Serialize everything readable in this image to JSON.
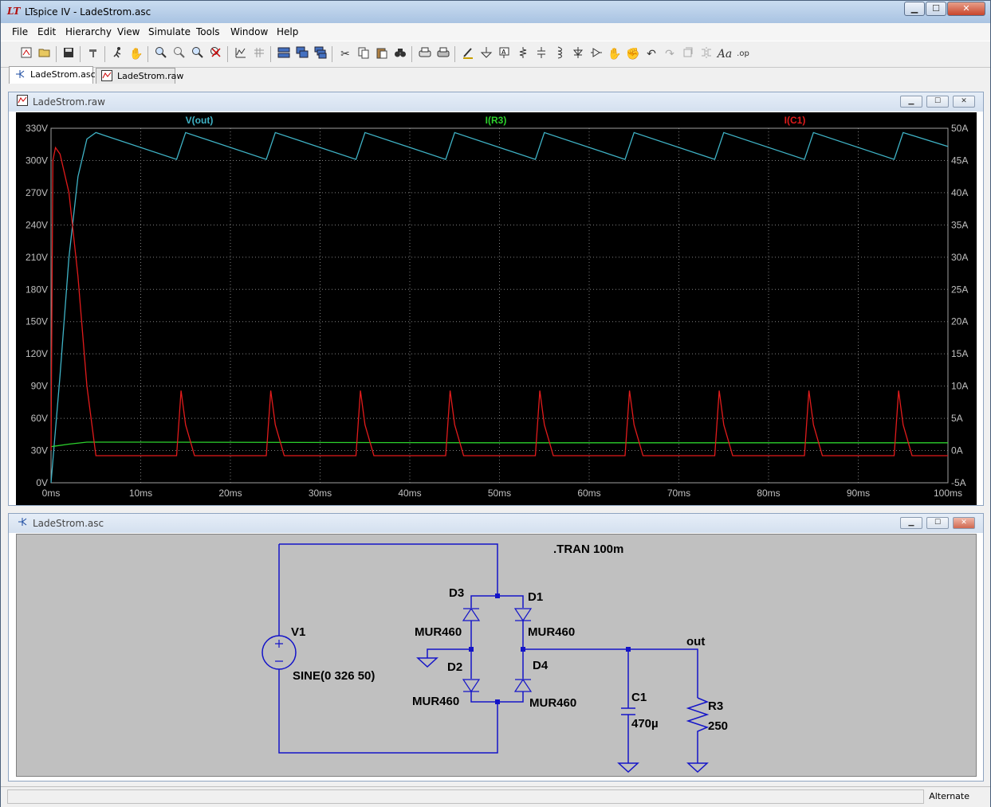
{
  "window": {
    "title": "LTspice IV - LadeStrom.asc",
    "min_label": "▁",
    "max_label": "☐",
    "close_label": "✕"
  },
  "menu": [
    "File",
    "Edit",
    "Hierarchy",
    "View",
    "Simulate",
    "Tools",
    "Window",
    "Help"
  ],
  "toolbar_icons": [
    "new-schematic-icon",
    "open-icon",
    "save-icon",
    "hammer-icon",
    "run-icon",
    "hand-pan-icon",
    "zoom-in-icon",
    "zoom-search-icon",
    "zoom-out-icon",
    "zoom-cancel-icon",
    "autorange-icon",
    "grid-icon",
    "tile-horizontal-icon",
    "cascade-icon",
    "tile-vertical-icon",
    "cut-icon",
    "copy-icon",
    "paste-icon",
    "find-icon",
    "print-setup-icon",
    "print-icon",
    "draw-wire-icon",
    "ground-icon",
    "label-net-icon",
    "resistor-icon",
    "capacitor-icon",
    "inductor-icon",
    "diode-icon",
    "component-icon",
    "move-icon",
    "drag-icon",
    "undo-icon",
    "redo-icon",
    "rotate-icon",
    "mirror-icon",
    "text-icon",
    "spice-directive-icon"
  ],
  "tabs": [
    {
      "label": "LadeStrom.asc",
      "icon": "schematic-icon",
      "active": true
    },
    {
      "label": "LadeStrom.raw",
      "icon": "waveform-icon",
      "active": false
    }
  ],
  "plot_window": {
    "title": "LadeStrom.raw",
    "traces": [
      {
        "label": "V(out)",
        "color": "#3fb3c6"
      },
      {
        "label": "I(R3)",
        "color": "#2cd12c"
      },
      {
        "label": "I(C1)",
        "color": "#e11b1b"
      }
    ],
    "left_ticks": [
      "330V",
      "300V",
      "270V",
      "240V",
      "210V",
      "180V",
      "150V",
      "120V",
      "90V",
      "60V",
      "30V",
      "0V"
    ],
    "right_ticks": [
      "50A",
      "45A",
      "40A",
      "35A",
      "30A",
      "25A",
      "20A",
      "15A",
      "10A",
      "5A",
      "0A",
      "-5A"
    ],
    "x_ticks": [
      "0ms",
      "10ms",
      "20ms",
      "30ms",
      "40ms",
      "50ms",
      "60ms",
      "70ms",
      "80ms",
      "90ms",
      "100ms"
    ]
  },
  "chart_data": {
    "type": "line",
    "x_unit": "ms",
    "xlim": [
      0,
      100
    ],
    "ylim_left": [
      0,
      330
    ],
    "ylim_right": [
      -5,
      50
    ],
    "series": [
      {
        "name": "V(out)",
        "axis": "left",
        "x": [
          0,
          1,
          2,
          3,
          4,
          5,
          14,
          15,
          24,
          25,
          34,
          35,
          44,
          45,
          54,
          55,
          64,
          65,
          74,
          75,
          84,
          85,
          94,
          95,
          100
        ],
        "y": [
          0,
          100,
          210,
          285,
          320,
          326,
          301,
          326,
          301,
          326,
          301,
          326,
          301,
          326,
          301,
          326,
          301,
          326,
          301,
          326,
          301,
          326,
          301,
          326,
          313
        ]
      },
      {
        "name": "I(R3)",
        "axis": "right",
        "x": [
          0,
          2,
          4,
          5,
          10,
          50,
          100
        ],
        "y": [
          0.6,
          1.0,
          1.3,
          1.3,
          1.3,
          1.2,
          1.2
        ]
      },
      {
        "name": "I(C1)",
        "axis": "right",
        "x": [
          0,
          0.2,
          0.5,
          1,
          2,
          3,
          4,
          5,
          14,
          14.5,
          15,
          16,
          24,
          24.5,
          25,
          26,
          34,
          34.5,
          35,
          36,
          44,
          44.5,
          45,
          46,
          54,
          54.5,
          55,
          56,
          64,
          64.5,
          65,
          66,
          74,
          74.5,
          75,
          76,
          84,
          84.5,
          85,
          86,
          94,
          94.5,
          95,
          96,
          100
        ],
        "y": [
          0,
          45,
          47,
          46,
          40,
          27,
          10,
          -0.8,
          -0.8,
          9.3,
          4,
          -0.8,
          -0.8,
          9.3,
          4,
          -0.8,
          -0.8,
          9.3,
          4,
          -0.8,
          -0.8,
          9.3,
          4,
          -0.8,
          -0.8,
          9.3,
          4,
          -0.8,
          -0.8,
          9.3,
          4,
          -0.8,
          -0.8,
          9.3,
          4,
          -0.8,
          -0.8,
          9.3,
          4,
          -0.8,
          -0.8,
          9.3,
          4,
          -0.8,
          -0.8
        ]
      }
    ]
  },
  "schematic_window": {
    "title": "LadeStrom.asc",
    "directive": ".TRAN 100m",
    "labels": {
      "v1": "V1",
      "v1_value": "SINE(0 326 50)",
      "d1": "D1",
      "d2": "D2",
      "d3": "D3",
      "d4": "D4",
      "d1_model": "MUR460",
      "d2_model": "MUR460",
      "d3_model": "MUR460",
      "d4_model": "MUR460",
      "c1": "C1",
      "c1_value": "470µ",
      "r3": "R3",
      "r3_value": "250",
      "net_out": "out"
    }
  },
  "status": {
    "text": "Alternate"
  }
}
